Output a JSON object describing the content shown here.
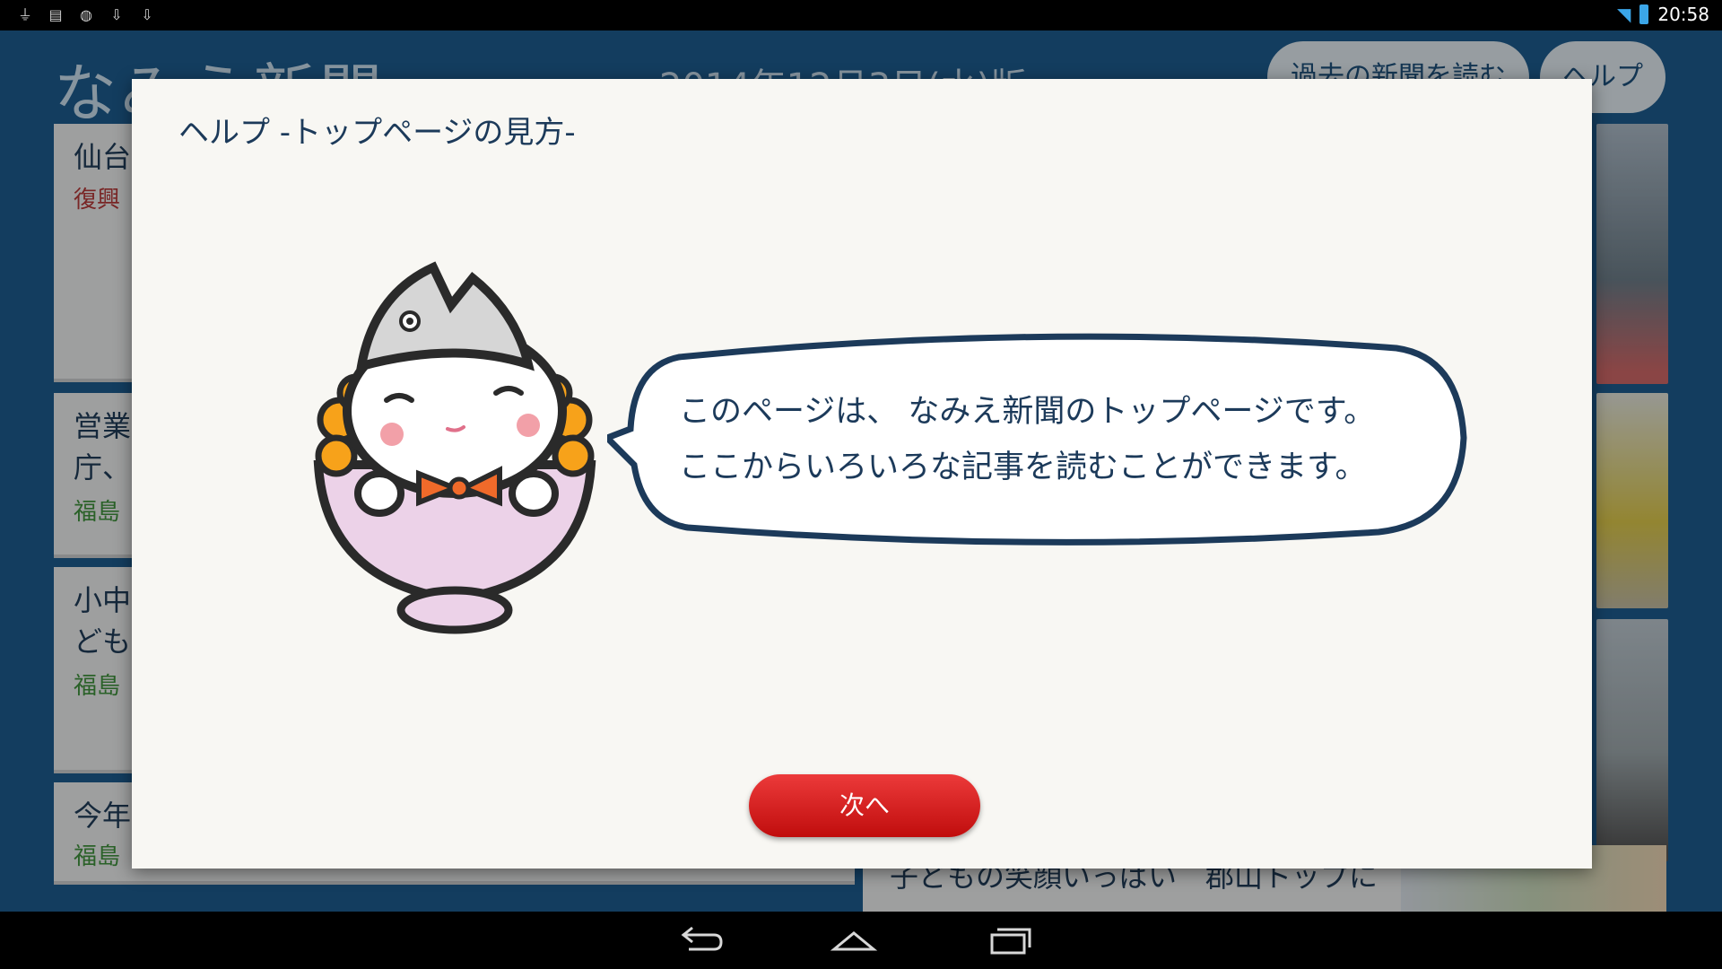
{
  "status_bar": {
    "time": "20:58",
    "icons": [
      "usb-icon",
      "news-icon",
      "game-icon",
      "download-icon",
      "download-icon"
    ]
  },
  "background": {
    "logo": "なみえ新聞",
    "edition": "2014年12月3日(水)版",
    "past_button": "過去の新聞を読む",
    "help_button": "ヘルプ",
    "cards": [
      {
        "title": "仙台",
        "subtitle": "復興"
      },
      {
        "title": "営業",
        "title2": "庁、",
        "subtitle": "福島"
      },
      {
        "title": "小中",
        "title2": "ども",
        "subtitle": "福島"
      },
      {
        "title": "今年",
        "subtitle": "福島"
      }
    ],
    "bottom_headline": "子どもの笑顔いっぱい　郡山トップに"
  },
  "modal": {
    "title": "ヘルプ -トップページの見方-",
    "bubble_line1": "このページは、 なみえ新聞のトップページです。",
    "bubble_line2": "ここからいろいろな記事を読むことができます。",
    "next_button": "次へ"
  },
  "colors": {
    "accent": "#1c5a8c",
    "button_red": "#d41e1e",
    "text_dark": "#1c3a5a",
    "subtitle_red": "#b33939",
    "subtitle_green": "#3f8f3c"
  }
}
